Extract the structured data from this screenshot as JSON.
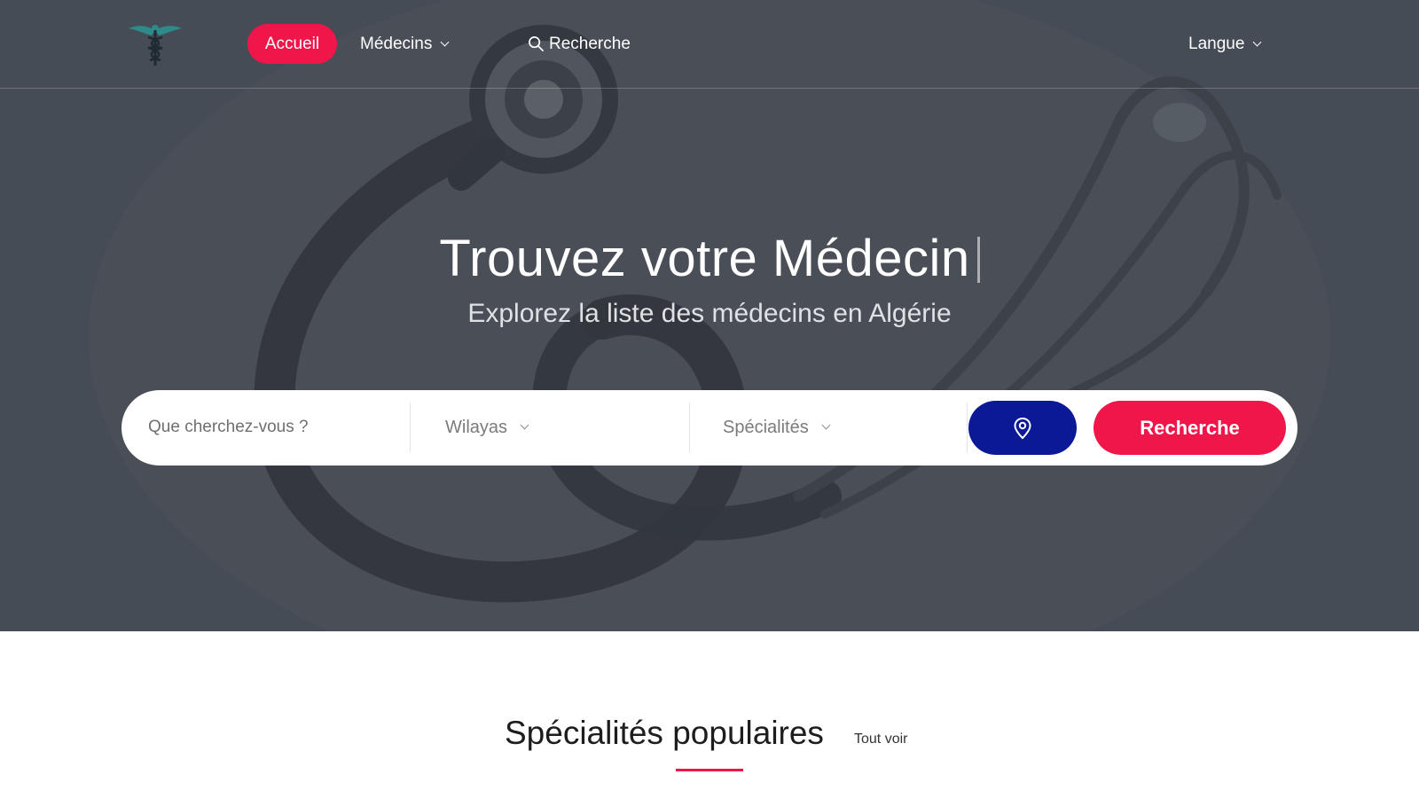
{
  "colors": {
    "accent": "#f0164a",
    "location_button": "#0b1996",
    "hero_overlay": "#4a5059"
  },
  "nav": {
    "logo_icon": "caduceus-icon",
    "items": [
      {
        "label": "Accueil",
        "active": true
      },
      {
        "label": "Médecins",
        "dropdown": true
      },
      {
        "label": "Recherche",
        "icon": "search-icon"
      },
      {
        "label": "Langue",
        "dropdown": true
      }
    ]
  },
  "hero": {
    "title": "Trouvez votre Médecin",
    "subtitle": "Explorez la liste des médecins en Algérie",
    "background_icon": "stethoscope-image"
  },
  "search": {
    "placeholder": "Que cherchez-vous ?",
    "wilayas_label": "Wilayas",
    "specialites_label": "Spécialités",
    "location_icon": "map-pin-icon",
    "submit_label": "Recherche"
  },
  "popular": {
    "title": "Spécialités populaires",
    "see_all_label": "Tout voir"
  }
}
